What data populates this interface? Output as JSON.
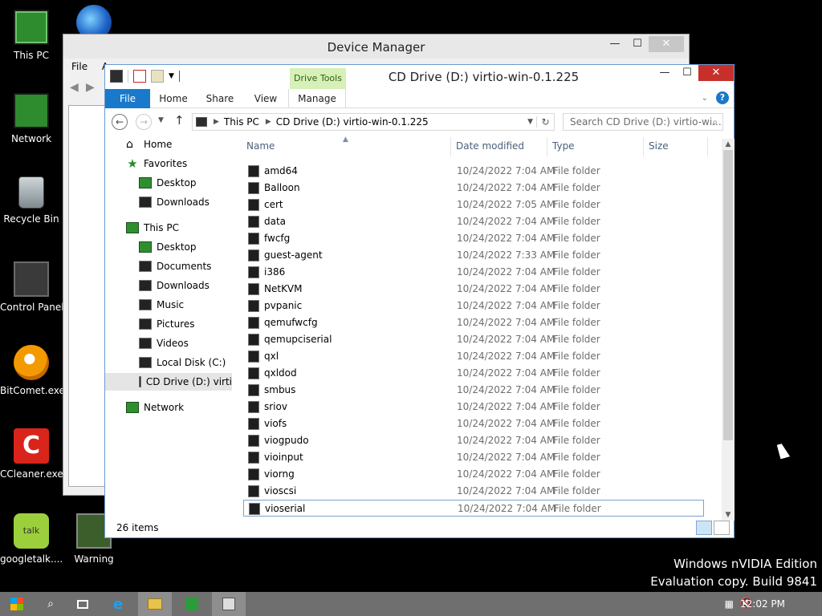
{
  "desktop": {
    "icons": [
      {
        "label": "This PC",
        "icon": "monitor-icon"
      },
      {
        "label": "Network",
        "icon": "network-icon"
      },
      {
        "label": "Recycle Bin",
        "icon": "recycle-bin-icon"
      },
      {
        "label": "Control Panel",
        "icon": "control-panel-icon"
      },
      {
        "label": "BitComet.exe",
        "icon": "bitcomet-icon"
      },
      {
        "label": "CCleaner.exe",
        "icon": "ccleaner-icon"
      },
      {
        "label": "googletalk....",
        "icon": "googletalk-icon"
      },
      {
        "label": "Warning",
        "icon": "warning-icon"
      }
    ],
    "ccleaner_glyph": "C",
    "talk_glyph": "talk",
    "watermark": {
      "line1": "Windows nVIDIA Edition",
      "line2": "Evaluation copy. Build 9841"
    }
  },
  "device_manager": {
    "title": "Device Manager",
    "menu_file": "File",
    "menu_action": "A"
  },
  "explorer": {
    "title": "CD Drive (D:) virtio-win-0.1.225",
    "contextual_tab": "Drive Tools",
    "ribbon_tabs": [
      "File",
      "Home",
      "Share",
      "View",
      "Manage"
    ],
    "address": {
      "root": "This PC",
      "current": "CD Drive (D:) virtio-win-0.1.225"
    },
    "search_placeholder": "Search CD Drive (D:) virtio-wi...",
    "columns": {
      "name": "Name",
      "date": "Date modified",
      "type": "Type",
      "size": "Size"
    },
    "nav": [
      {
        "label": "Home",
        "level": 0,
        "icon": "home-icon"
      },
      {
        "label": "Favorites",
        "level": 0,
        "icon": "star-icon"
      },
      {
        "label": "Desktop",
        "level": 1,
        "icon": "desktop-folder-icon"
      },
      {
        "label": "Downloads",
        "level": 1,
        "icon": "downloads-folder-icon"
      },
      {
        "label": "This PC",
        "level": 0,
        "icon": "monitor-icon"
      },
      {
        "label": "Desktop",
        "level": 1,
        "icon": "desktop-folder-icon"
      },
      {
        "label": "Documents",
        "level": 1,
        "icon": "documents-folder-icon"
      },
      {
        "label": "Downloads",
        "level": 1,
        "icon": "downloads-folder-icon"
      },
      {
        "label": "Music",
        "level": 1,
        "icon": "music-folder-icon"
      },
      {
        "label": "Pictures",
        "level": 1,
        "icon": "pictures-folder-icon"
      },
      {
        "label": "Videos",
        "level": 1,
        "icon": "videos-folder-icon"
      },
      {
        "label": "Local Disk (C:)",
        "level": 1,
        "icon": "local-disk-icon"
      },
      {
        "label": "CD Drive (D:) virti",
        "level": 1,
        "icon": "cd-drive-icon"
      },
      {
        "label": "Network",
        "level": 0,
        "icon": "network-icon"
      }
    ],
    "files": [
      {
        "name": "amd64",
        "date": "10/24/2022 7:04 AM",
        "type": "File folder"
      },
      {
        "name": "Balloon",
        "date": "10/24/2022 7:04 AM",
        "type": "File folder"
      },
      {
        "name": "cert",
        "date": "10/24/2022 7:05 AM",
        "type": "File folder"
      },
      {
        "name": "data",
        "date": "10/24/2022 7:04 AM",
        "type": "File folder"
      },
      {
        "name": "fwcfg",
        "date": "10/24/2022 7:04 AM",
        "type": "File folder"
      },
      {
        "name": "guest-agent",
        "date": "10/24/2022 7:33 AM",
        "type": "File folder"
      },
      {
        "name": "i386",
        "date": "10/24/2022 7:04 AM",
        "type": "File folder"
      },
      {
        "name": "NetKVM",
        "date": "10/24/2022 7:04 AM",
        "type": "File folder"
      },
      {
        "name": "pvpanic",
        "date": "10/24/2022 7:04 AM",
        "type": "File folder"
      },
      {
        "name": "qemufwcfg",
        "date": "10/24/2022 7:04 AM",
        "type": "File folder"
      },
      {
        "name": "qemupciserial",
        "date": "10/24/2022 7:04 AM",
        "type": "File folder"
      },
      {
        "name": "qxl",
        "date": "10/24/2022 7:04 AM",
        "type": "File folder"
      },
      {
        "name": "qxldod",
        "date": "10/24/2022 7:04 AM",
        "type": "File folder"
      },
      {
        "name": "smbus",
        "date": "10/24/2022 7:04 AM",
        "type": "File folder"
      },
      {
        "name": "sriov",
        "date": "10/24/2022 7:04 AM",
        "type": "File folder"
      },
      {
        "name": "viofs",
        "date": "10/24/2022 7:04 AM",
        "type": "File folder"
      },
      {
        "name": "viogpudo",
        "date": "10/24/2022 7:04 AM",
        "type": "File folder"
      },
      {
        "name": "vioinput",
        "date": "10/24/2022 7:04 AM",
        "type": "File folder"
      },
      {
        "name": "viorng",
        "date": "10/24/2022 7:04 AM",
        "type": "File folder"
      },
      {
        "name": "vioscsi",
        "date": "10/24/2022 7:04 AM",
        "type": "File folder"
      },
      {
        "name": "vioserial",
        "date": "10/24/2022 7:04 AM",
        "type": "File folder"
      }
    ],
    "focused_file": "vioserial",
    "status_count": "26 items"
  },
  "taskbar": {
    "clock": "12:02 PM",
    "buttons": [
      "start-icon",
      "search-icon",
      "task-view-icon",
      "internet-explorer-icon",
      "file-explorer-icon",
      "store-icon",
      "device-manager-icon"
    ]
  },
  "colors": {
    "accent": "#1979ca",
    "close": "#c7302a",
    "drive_tools": "#d6f0b8"
  }
}
